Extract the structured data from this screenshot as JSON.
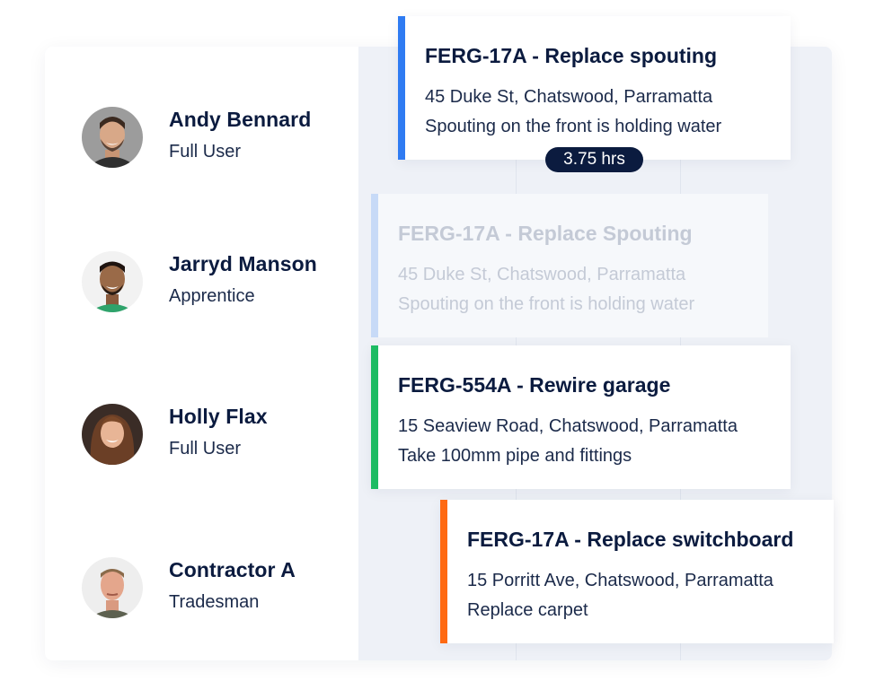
{
  "colors": {
    "accent_blue": "#2f7bf2",
    "accent_ghost": "#c7daf7",
    "accent_green": "#1dbb63",
    "accent_orange": "#ff6a13",
    "navy": "#0b1b3f"
  },
  "staff": [
    {
      "name": "Andy Bennard",
      "role": "Full User",
      "avatar_icon": "avatar-photo"
    },
    {
      "name": "Jarryd Manson",
      "role": "Apprentice",
      "avatar_icon": "avatar-photo"
    },
    {
      "name": "Holly Flax",
      "role": "Full User",
      "avatar_icon": "avatar-photo"
    },
    {
      "name": "Contractor A",
      "role": "Tradesman",
      "avatar_icon": "avatar-photo"
    }
  ],
  "jobs": [
    {
      "title": "FERG-17A - Replace spouting",
      "address": "45 Duke St, Chatswood, Parramatta",
      "note": "Spouting on the front is holding water",
      "duration": "3.75 hrs"
    },
    {
      "title": "FERG-17A - Replace Spouting",
      "address": "45 Duke St, Chatswood, Parramatta",
      "note": "Spouting on the front is holding water"
    },
    {
      "title": "FERG-554A - Rewire garage",
      "address": "15 Seaview Road, Chatswood, Parramatta",
      "note": "Take 100mm pipe and fittings"
    },
    {
      "title": "FERG-17A - Replace switchboard",
      "address": "15 Porritt Ave, Chatswood, Parramatta",
      "note": "Replace carpet"
    }
  ]
}
